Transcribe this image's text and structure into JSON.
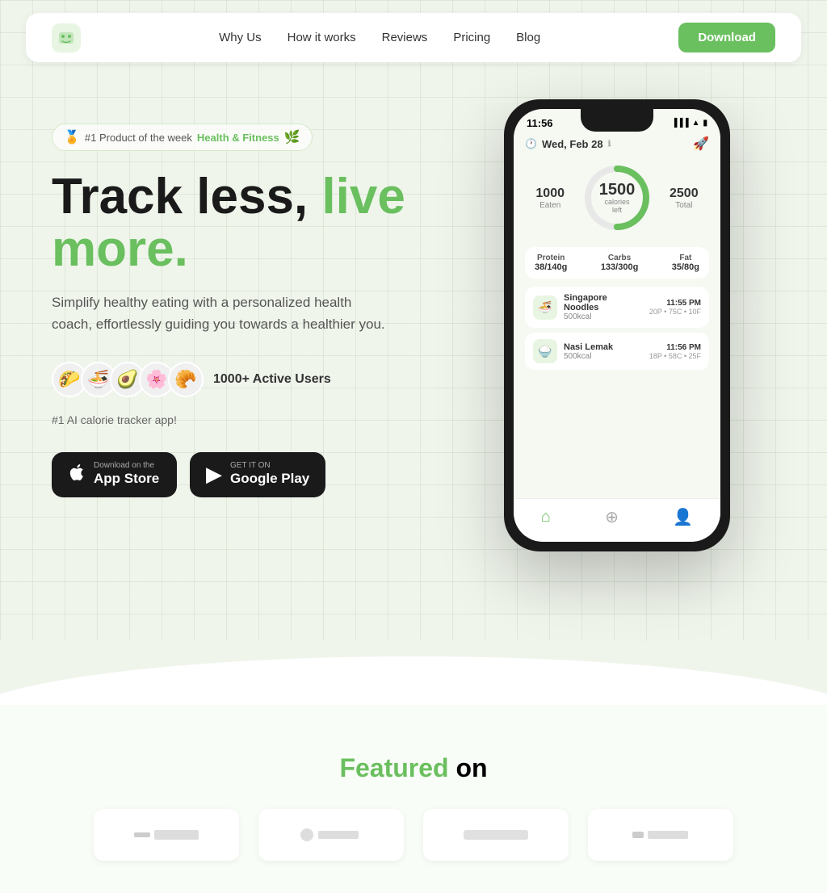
{
  "nav": {
    "logo_emoji": "🤖",
    "links": [
      {
        "label": "Why Us",
        "id": "why-us"
      },
      {
        "label": "How it works",
        "id": "how-it-works"
      },
      {
        "label": "Reviews",
        "id": "reviews"
      },
      {
        "label": "Pricing",
        "id": "pricing"
      },
      {
        "label": "Blog",
        "id": "blog"
      }
    ],
    "download_label": "Download"
  },
  "badge": {
    "prefix": "#1 Product of the week",
    "highlight": "Health & Fitness"
  },
  "hero": {
    "headline_black": "Track less,",
    "headline_green": "live more.",
    "subtitle": "Simplify healthy eating with a personalized health coach, effortlessly guiding you towards a healthier you.",
    "user_count": "1000+ Active Users",
    "tagline": "#1 AI calorie tracker app!",
    "avatars": [
      "🌮",
      "🍜",
      "🥑",
      "🌸",
      "🥐"
    ]
  },
  "store_buttons": {
    "appstore": {
      "small": "Download on the",
      "big": "App Store",
      "icon": ""
    },
    "playstore": {
      "small": "GET IT ON",
      "big": "Google Play",
      "icon": "▶"
    }
  },
  "phone": {
    "time": "11:56",
    "date": "Wed, Feb 28",
    "calories_eaten": "1000",
    "calories_eaten_label": "Eaten",
    "calories_left": "1500",
    "calories_left_label": "calories\nleft",
    "calories_total": "2500",
    "calories_total_label": "Total",
    "macros": [
      {
        "name": "Protein",
        "value": "38/140g"
      },
      {
        "name": "Carbs",
        "value": "133/300g"
      },
      {
        "name": "Fat",
        "value": "35/80g"
      }
    ],
    "food_items": [
      {
        "name": "Singapore Noodles",
        "kcal": "500kcal",
        "time": "11:55 PM",
        "meta": "20P • 75C • 10F",
        "icon": "🍜"
      },
      {
        "name": "Nasi Lemak",
        "kcal": "500kcal",
        "time": "11:56 PM",
        "meta": "18P • 58C • 25F",
        "icon": "🍚"
      }
    ]
  },
  "featured": {
    "title_green": "Featured",
    "title_black": "on",
    "logos": [
      {
        "text": "━━━ ━━━━━━",
        "id": "logo1"
      },
      {
        "text": "━━━ ━━━━━",
        "id": "logo2"
      },
      {
        "text": "━━━━━━━━━",
        "id": "logo3"
      },
      {
        "text": "━━━ ━━━━━",
        "id": "logo4"
      }
    ]
  }
}
